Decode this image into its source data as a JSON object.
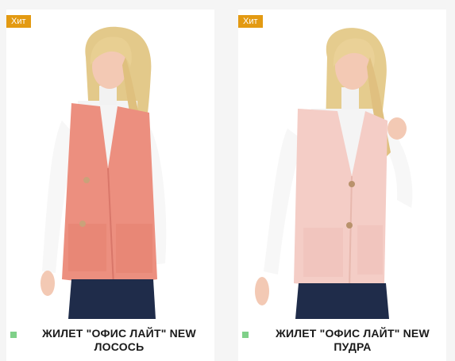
{
  "products": [
    {
      "badge": "Хит",
      "name_line1": "ЖИЛЕТ \"ОФИС ЛАЙТ\" NEW",
      "name_line2": "ЛОСОСЬ",
      "vest_color": "#ec8f7f"
    },
    {
      "badge": "Хит",
      "name_line1": "ЖИЛЕТ \"ОФИС ЛАЙТ\" NEW",
      "name_line2": "ПУДРА",
      "vest_color": "#f4cdc6"
    }
  ],
  "colors": {
    "badge_bg": "#e39a12",
    "status_dot": "#7fd089"
  }
}
